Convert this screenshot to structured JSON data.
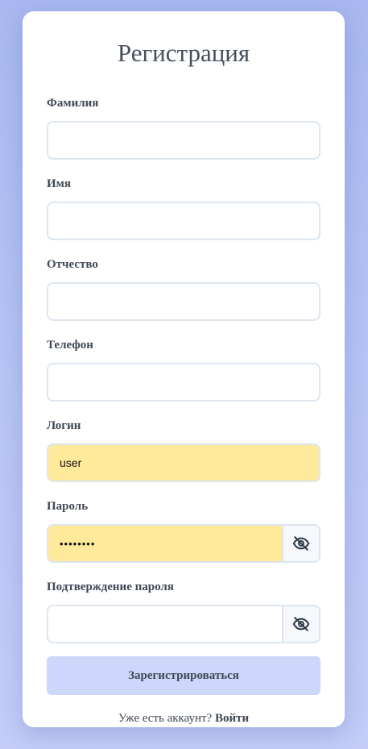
{
  "form": {
    "title": "Регистрация",
    "fields": [
      {
        "label": "Фамилия",
        "value": "",
        "type": "text"
      },
      {
        "label": "Имя",
        "value": "",
        "type": "text"
      },
      {
        "label": "Отчество",
        "value": "",
        "type": "text"
      },
      {
        "label": "Телефон",
        "value": "",
        "type": "text"
      },
      {
        "label": "Логин",
        "value": "user",
        "type": "text",
        "autofilled": true
      },
      {
        "label": "Пароль",
        "value": "12345678",
        "type": "password",
        "autofilled": true,
        "icon": "eye-slash-icon"
      },
      {
        "label": "Подтверждение пароля",
        "value": "",
        "type": "password",
        "icon": "eye-slash-icon"
      }
    ],
    "submit_label": "Зарегистрироваться",
    "footer": {
      "text": "Уже есть аккаунт?",
      "link": "Войти"
    }
  },
  "colors": {
    "background_top": "#a9b8f0",
    "autofill": "#ffe99b",
    "submit_bg": "#ccd7fb",
    "text": "#3f4754"
  }
}
